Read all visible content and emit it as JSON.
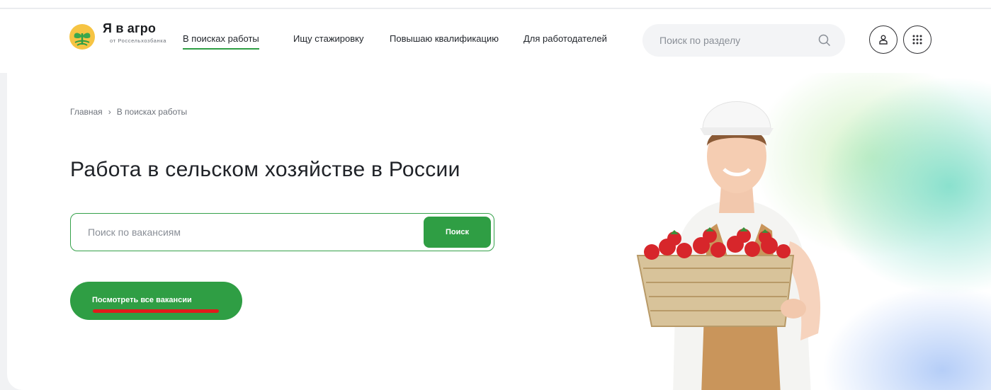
{
  "brand": {
    "title": "Я в агро",
    "subtitle": "от Россельхозбанка"
  },
  "nav": [
    {
      "label": "В поисках работы",
      "active": true
    },
    {
      "label": "Ищу стажировку",
      "active": false
    },
    {
      "label": "Повышаю квалификацию",
      "active": false
    },
    {
      "label": "Для работодателей",
      "active": false
    }
  ],
  "header_search": {
    "placeholder": "Поиск по разделу",
    "icon": "search-icon"
  },
  "header_buttons": [
    {
      "icon": "user-icon"
    },
    {
      "icon": "apps-grid-icon"
    }
  ],
  "breadcrumb": {
    "home": "Главная",
    "separator": "›",
    "current": "В поисках работы"
  },
  "hero": {
    "title": "Работа в сельском хозяйстве в России",
    "search_placeholder": "Поиск по вакансиям",
    "search_button": "Поиск",
    "all_vacancies_button": "Посмотреть все вакансии",
    "image": "woman-with-strawberry-basket"
  },
  "colors": {
    "accent": "#2f9e44",
    "highlight_mark": "#e01b1b",
    "page_bg": "#f1f2f4"
  }
}
